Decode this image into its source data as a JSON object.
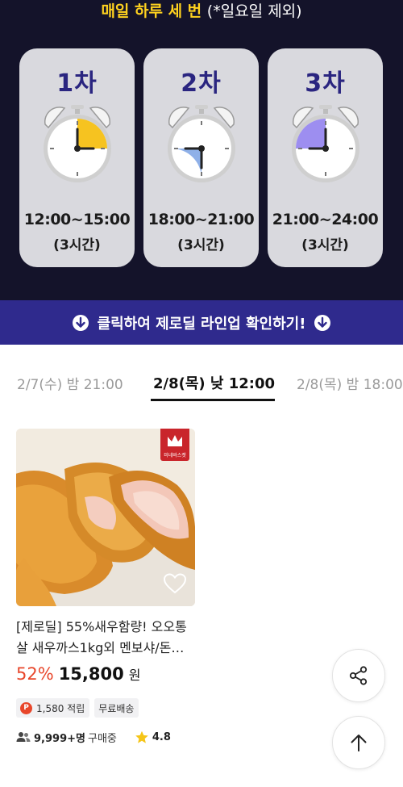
{
  "banner": {
    "title_highlight": "매일 하루 세 번",
    "title_note": "(*일요일 제외)",
    "sessions": [
      {
        "round": "1차",
        "time": "12:00~15:00",
        "duration": "(3시간)",
        "color": "#f6c320"
      },
      {
        "round": "2차",
        "time": "18:00~21:00",
        "duration": "(3시간)",
        "color": "#8fb0e8"
      },
      {
        "round": "3차",
        "time": "21:00~24:00",
        "duration": "(3시간)",
        "color": "#9d8ef0"
      }
    ]
  },
  "cta": {
    "label": "클릭하여 제로딜 라인업 확인하기!"
  },
  "tabs": [
    {
      "label": "2/7(수) 밤 21:00",
      "active": false
    },
    {
      "label": "2/8(목) 낮 12:00",
      "active": true
    },
    {
      "label": "2/8(목) 밤 18:00",
      "active": false
    }
  ],
  "product": {
    "brand_badge": "미네바스켓",
    "title_line1": "[제로딜] 55%새우함량! 오오통",
    "title_line2": "살 새우까스1kg외 멘보샤/돈…",
    "discount": "52%",
    "price": "15,800",
    "currency": "원",
    "points_icon": "P",
    "points": "1,580 적립",
    "shipping": "무료배송",
    "buyers": "9,999+명",
    "buyers_suffix": "구매중",
    "rating": "4.8"
  },
  "colors": {
    "banner_bg": "#14132a",
    "cta_bg": "#2f2a8d",
    "accent_yellow": "#ffd21f",
    "discount_red": "#e8462a"
  },
  "icons": {
    "cta": "arrow-down-circle-icon",
    "share": "share-icon",
    "top": "arrow-up-icon",
    "heart": "heart-icon",
    "buyers": "users-icon",
    "rating": "star-icon"
  }
}
